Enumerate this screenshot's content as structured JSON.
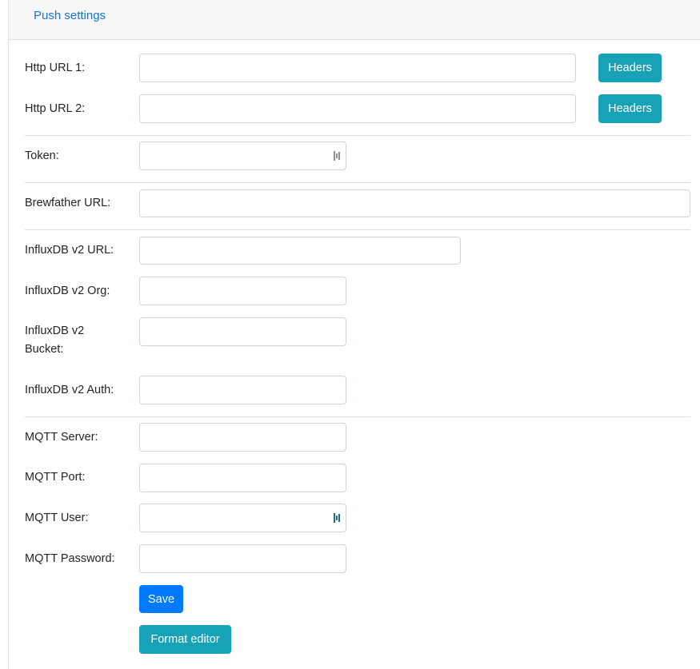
{
  "header": {
    "tab": "Push settings"
  },
  "http": {
    "url1_label": "Http URL 1:",
    "url1_value": "",
    "url2_label": "Http URL 2:",
    "url2_value": "",
    "headers_button": "Headers"
  },
  "token": {
    "label": "Token:",
    "value": "",
    "icon": "password-manager-icon"
  },
  "brewfather": {
    "label": "Brewfather URL:",
    "value": ""
  },
  "influx": {
    "url_label": "InfluxDB v2 URL:",
    "url_value": "",
    "org_label": "InfluxDB v2 Org:",
    "org_value": "",
    "bucket_label": "InfluxDB v2 Bucket:",
    "bucket_value": "",
    "auth_label": "InfluxDB v2 Auth:",
    "auth_value": ""
  },
  "mqtt": {
    "server_label": "MQTT Server:",
    "server_value": "",
    "port_label": "MQTT Port:",
    "port_value": "",
    "user_label": "MQTT User:",
    "user_value": "",
    "password_label": "MQTT Password:",
    "password_value": ""
  },
  "actions": {
    "save": "Save",
    "format_editor": "Format editor"
  },
  "colors": {
    "info": "#17a2b8",
    "primary": "#007bff",
    "link": "#1a73c9"
  }
}
